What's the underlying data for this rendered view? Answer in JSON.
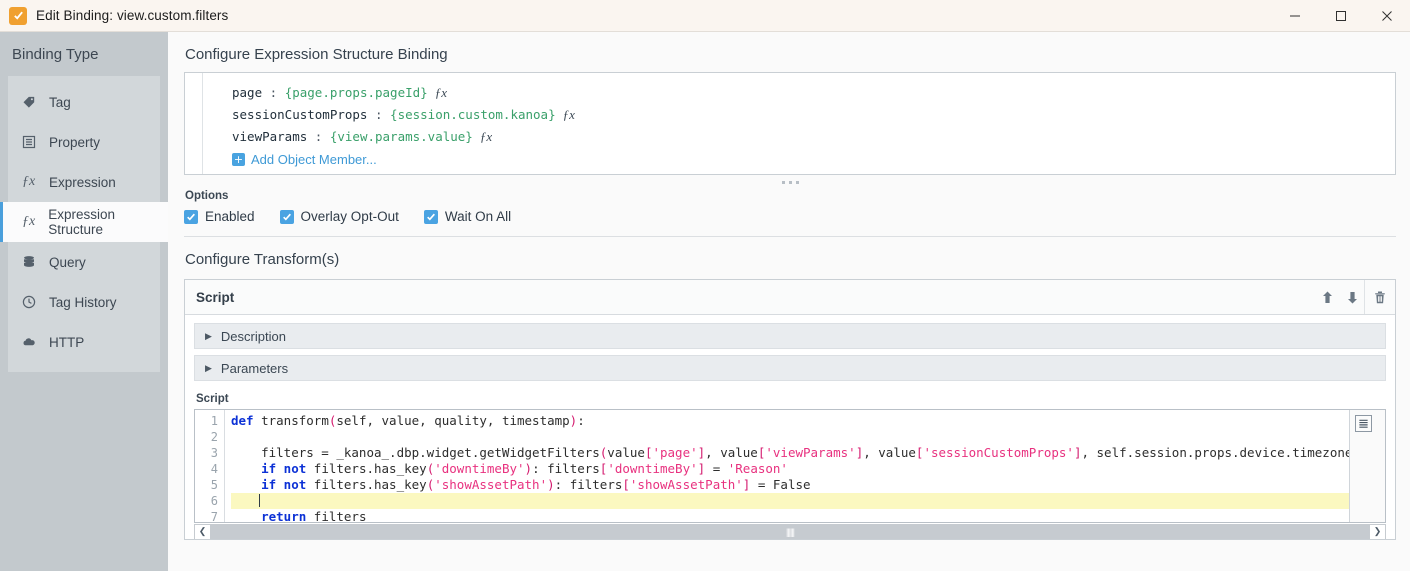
{
  "window": {
    "title": "Edit Binding: view.custom.filters",
    "app_icon": "checkmark-icon",
    "minimize_label": "—",
    "maximize_label": "☐",
    "close_label": "✕"
  },
  "sidebar": {
    "title": "Binding Type",
    "items": [
      {
        "label": "Tag",
        "icon": "tag-icon",
        "selected": false
      },
      {
        "label": "Property",
        "icon": "property-icon",
        "selected": false
      },
      {
        "label": "Expression",
        "icon": "fx-icon",
        "selected": false
      },
      {
        "label": "Expression Structure",
        "icon": "fx-icon",
        "selected": true
      },
      {
        "label": "Query",
        "icon": "database-icon",
        "selected": false
      },
      {
        "label": "Tag History",
        "icon": "clock-icon",
        "selected": false
      },
      {
        "label": "HTTP",
        "icon": "cloud-icon",
        "selected": false
      }
    ]
  },
  "main": {
    "configure_heading": "Configure Expression Structure Binding",
    "expression_rows": [
      {
        "key": "page",
        "separator": " : ",
        "value": "{page.props.pageId}",
        "fx": "ƒx"
      },
      {
        "key": "sessionCustomProps",
        "separator": " : ",
        "value": "{session.custom.kanoa}",
        "fx": "ƒx"
      },
      {
        "key": "viewParams",
        "separator": " : ",
        "value": "{view.params.value}",
        "fx": "ƒx"
      }
    ],
    "add_member_label": "Add Object Member...",
    "add_member_plus": "+",
    "options_label": "Options",
    "options": [
      {
        "label": "Enabled",
        "checked": true
      },
      {
        "label": "Overlay Opt-Out",
        "checked": true
      },
      {
        "label": "Wait On All",
        "checked": true
      }
    ],
    "transforms_heading": "Configure Transform(s)",
    "script_card": {
      "title": "Script",
      "toolbar": [
        {
          "name": "move-up-button",
          "glyph": "⬆"
        },
        {
          "name": "move-down-button",
          "glyph": "⬇"
        },
        {
          "name": "delete-button",
          "glyph": "🗑"
        }
      ],
      "accordions": [
        {
          "label": "Description",
          "expanded": false,
          "triangle": "▶"
        },
        {
          "label": "Parameters",
          "expanded": false,
          "triangle": "▶"
        }
      ],
      "code_label": "Script",
      "line_numbers": [
        "1",
        "2",
        "3",
        "4",
        "5",
        "6",
        "7"
      ],
      "highlighted_line": 6,
      "code_lines": [
        "def transform(self, value, quality, timestamp):",
        "",
        "    filters = _kanoa_.dbp.widget.getWidgetFilters(value['page'], value['viewParams'], value['sessionCustomProps'], self.session.props.device.timezone.id)",
        "    if not filters.has_key('downtimeBy'): filters['downtimeBy'] = 'Reason'",
        "    if not filters.has_key('showAssetPath'): filters['showAssetPath'] = False",
        "",
        "    return filters"
      ]
    }
  },
  "colors": {
    "accent": "#4a9fdc",
    "title_bar": "#faf5f0",
    "app_icon": "#f0a030",
    "sidebar": "#c3c9cd",
    "expression_value": "#3aa06a",
    "code_keyword": "#0d32d6",
    "code_string": "#e8317f",
    "highlight_line": "#fbf8c0"
  }
}
